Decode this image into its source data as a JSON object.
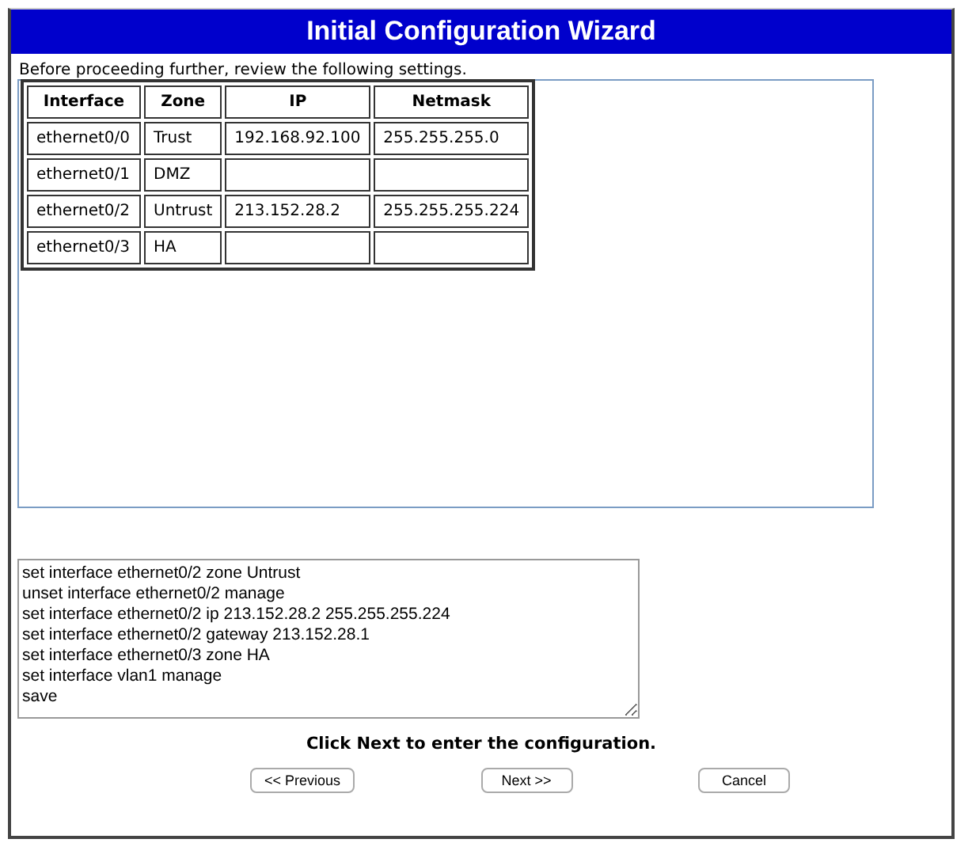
{
  "window": {
    "title": "Initial Configuration Wizard"
  },
  "intro": "Before proceeding further, review the following settings.",
  "table": {
    "columns": [
      "Interface",
      "Zone",
      "IP",
      "Netmask"
    ],
    "rows": [
      [
        "ethernet0/0",
        "Trust",
        "192.168.92.100",
        "255.255.255.0"
      ],
      [
        "ethernet0/1",
        "DMZ",
        "",
        ""
      ],
      [
        "ethernet0/2",
        "Untrust",
        "213.152.28.2",
        "255.255.255.224"
      ],
      [
        "ethernet0/3",
        "HA",
        "",
        ""
      ]
    ]
  },
  "script_lines": [
    "set interface ethernet0/2 zone Untrust",
    "unset interface ethernet0/2 manage",
    "set interface ethernet0/2 ip 213.152.28.2 255.255.255.224",
    "set interface ethernet0/2 gateway 213.152.28.1",
    "set interface ethernet0/3 zone HA",
    "set interface vlan1 manage",
    "save"
  ],
  "instruction": "Click Next to enter the configuration.",
  "buttons": [
    "<< Previous",
    "Next >>",
    "Cancel"
  ]
}
